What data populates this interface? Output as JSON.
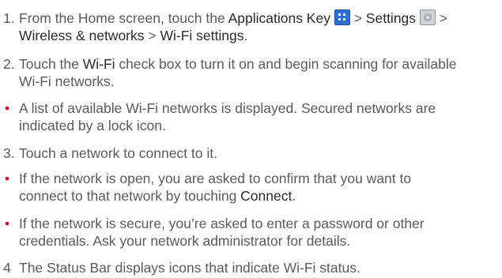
{
  "step1": {
    "number": "1.",
    "text_a": "From the Home screen, touch the ",
    "apps_key": "Applications Key",
    "sep1": " > ",
    "settings": "Settings",
    "sep2": " >",
    "wireless": "Wireless & networks",
    "sep3": " > ",
    "wifi_settings": "Wi-Fi settings",
    "end": ".",
    "icons": [
      "applications-key-icon",
      "settings-icon"
    ]
  },
  "step2": {
    "number": "2.",
    "text_a": "Touch the ",
    "wifi": "Wi-Fi",
    "text_b": " check box to turn it on and begin scanning for available",
    "line2": "Wi-Fi networks."
  },
  "bullet1": {
    "marker": "•",
    "line1": "A list of available Wi-Fi networks is displayed. Secured networks are",
    "line2": "indicated by a lock icon."
  },
  "step3": {
    "number": "3.",
    "text": "Touch a network to connect to it."
  },
  "bullet2": {
    "marker": "•",
    "line1": "If the network is open, you are asked to confirm that you want to",
    "line2_a": "connect to that network by touching ",
    "connect": "Connect",
    "end": "."
  },
  "bullet3": {
    "marker": "•",
    "line1": "If the network is secure, you’re asked to enter a password or other",
    "line2": "credentials. Ask your network administrator for details."
  },
  "step4": {
    "number": "4",
    "text": "The Status Bar displays icons that indicate Wi-Fi status."
  },
  "colors": {
    "bullet": "#c8102e",
    "body_text": "#5a5a5a",
    "ui_term": "#2a2a2a"
  }
}
